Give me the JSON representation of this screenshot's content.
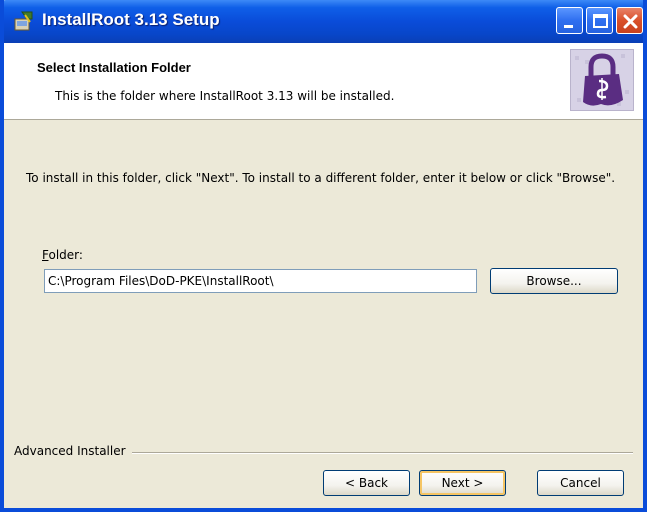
{
  "window": {
    "title": "InstallRoot 3.13 Setup"
  },
  "header": {
    "title": "Select Installation Folder",
    "subtitle": "This is the folder where InstallRoot 3.13 will be installed."
  },
  "body": {
    "instruction": "To install in this folder, click \"Next\". To install to a different folder, enter it below or click \"Browse\".",
    "folder_label_accel": "F",
    "folder_label_rest": "older:",
    "folder_value": "C:\\Program Files\\DoD-PKE\\InstallRoot\\",
    "browse_label": "Browse..."
  },
  "footer": {
    "brand": "Advanced Installer",
    "back_label": "< Back",
    "next_label": "Next >",
    "cancel_label": "Cancel"
  },
  "icons": {
    "app": "installer-icon",
    "logo": "padlock-icon",
    "minimize": "minimize-icon",
    "maximize": "maximize-icon",
    "close": "close-icon"
  },
  "colors": {
    "titlebar": "#0a4cd9",
    "dialog_bg": "#ece9d8",
    "close_button": "#d9502a",
    "logo_purple": "#5a2d82"
  }
}
